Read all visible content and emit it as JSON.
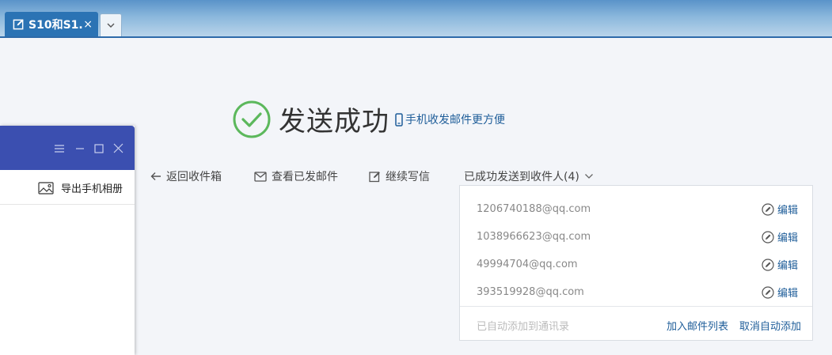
{
  "tab": {
    "title": "S10和S1...",
    "close": "×"
  },
  "success": {
    "title": "发送成功",
    "phone_link": "手机收发邮件更方便"
  },
  "actions": {
    "back": "返回收件箱",
    "view_sent": "查看已发邮件",
    "continue": "继续写信",
    "sent_to": "已成功发送到收件人(4)"
  },
  "recipients": [
    {
      "email": "1206740188@qq.com",
      "edit": "编辑"
    },
    {
      "email": "1038966623@qq.com",
      "edit": "编辑"
    },
    {
      "email": "49994704@qq.com",
      "edit": "编辑"
    },
    {
      "email": "393519928@qq.com",
      "edit": "编辑"
    }
  ],
  "recipients_footer": {
    "note": "已自动添加到通讯录",
    "add_list": "加入邮件列表",
    "cancel_auto": "取消自动添加"
  },
  "floating_window": {
    "export_label": "导出手机相册"
  },
  "colors": {
    "accent": "#2b73b4",
    "link": "#1e5d99",
    "success": "#5cb85c",
    "window_title": "#3b4fb0"
  }
}
